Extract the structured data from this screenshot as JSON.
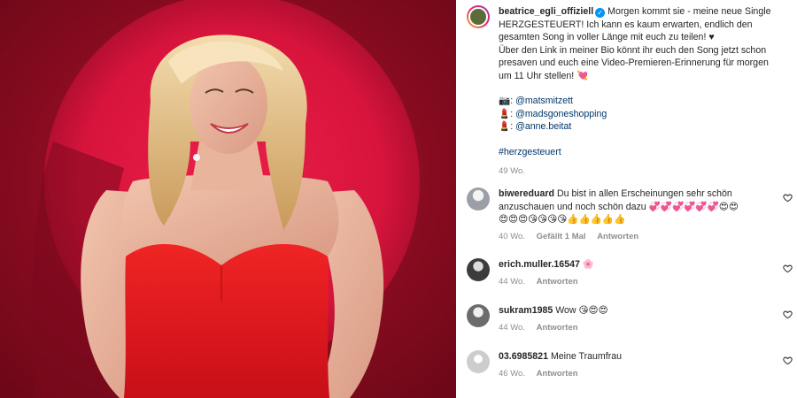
{
  "post": {
    "username": "beatrice_egli_offiziell",
    "caption_lines": [
      "Morgen kommt sie - meine neue Single",
      "HERZGESTEUERT! Ich kann es kaum erwarten, endlich den",
      "gesamten Song in voller Länge mit euch zu teilen! ♥",
      "Über den Link in meiner Bio könnt ihr euch den Song jetzt schon",
      "presaven und euch eine Video-Premieren-Erinnerung für morgen",
      "um 11 Uhr stellen! 💘"
    ],
    "credits": [
      {
        "emoji": "📷",
        "handle": "@matsmitzett"
      },
      {
        "emoji": "💄",
        "handle": "@madsgoneshopping"
      },
      {
        "emoji": "💄",
        "handle": "@anne.beitat"
      }
    ],
    "hashtag": "#herzgesteuert",
    "time": "49 Wo."
  },
  "comments": [
    {
      "username": "biwereduard",
      "text_lines": [
        "Du bist in allen Erscheinungen sehr schön",
        "anzuschauen und noch schön dazu 💞💞💞💞💞💞😍😍",
        "😍😍😍😘😘😘😘👍👍👍👍👍"
      ],
      "time": "40 Wo.",
      "likes": "Gefällt 1 Mal",
      "reply": "Antworten"
    },
    {
      "username": "erich.muller.16547",
      "text_lines": [
        "🌸"
      ],
      "time": "44 Wo.",
      "likes": "",
      "reply": "Antworten"
    },
    {
      "username": "sukram1985",
      "text_lines": [
        "Wow 😘😍😍"
      ],
      "time": "44 Wo.",
      "likes": "",
      "reply": "Antworten"
    },
    {
      "username": "03.6985821",
      "text_lines": [
        "Meine Traumfrau"
      ],
      "time": "46 Wo.",
      "likes": "",
      "reply": "Antworten"
    }
  ],
  "colors": {
    "background_red": "#8c0c22",
    "spot_red": "#d8143c",
    "dress_red": "#e0141f",
    "link_blue": "#00376b",
    "verified_blue": "#0095f6"
  },
  "icons": [
    "verified-badge-icon",
    "heart-outline-icon"
  ]
}
